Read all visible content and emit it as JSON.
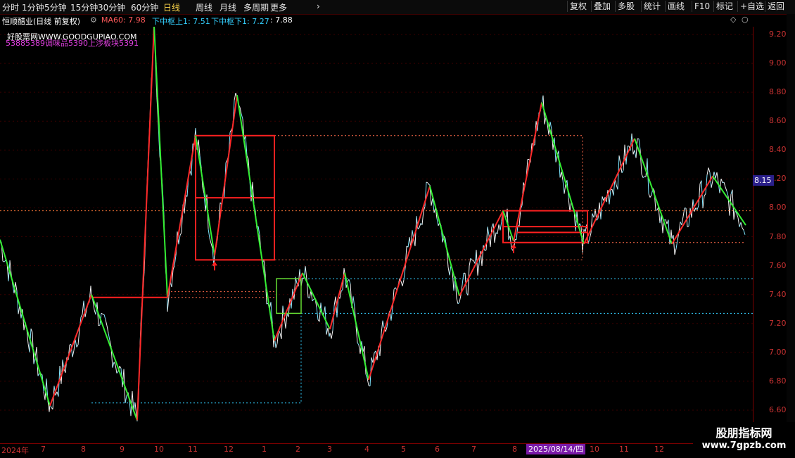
{
  "toolbar": {
    "periods": [
      "分时",
      "1分钟",
      "5分钟",
      "15分钟",
      "30分钟",
      "60分钟",
      "日线",
      "周线",
      "月线",
      "多周期",
      "更多"
    ],
    "active_period": "日线",
    "more_chevron": "›",
    "right_buttons": [
      "复权",
      "叠加",
      "多股",
      "统计",
      "画线",
      "F10",
      "标记",
      "+自选",
      "返回"
    ]
  },
  "info": {
    "stock": "恒顺醋业(日线 前复权)",
    "ma": "MA60: 7.98",
    "upper": "下中枢上1: 7.51",
    "lower": "下中枢下1: 7.27",
    "last": ": 7.88",
    "colors": {
      "ma": "#ff5a5a",
      "upper": "#33d0ff",
      "lower": "#33d0ff"
    }
  },
  "overlay": {
    "watermark": "好股票网WWW.GOODGUPIAO.COM",
    "pink_text": "53885389调味品5390上涉板块5391"
  },
  "price_tag": "8.15",
  "date_tag": "2025/08/14/四",
  "brand": {
    "line1": "股朋指标网",
    "line2": "www.7gpzb.com"
  },
  "chart_data": {
    "type": "line",
    "title": "",
    "xlabel": "",
    "ylabel": "",
    "ylim": [
      6.5,
      9.3
    ],
    "y_ticks": [
      6.6,
      6.8,
      7.0,
      7.2,
      7.4,
      7.6,
      7.8,
      8.0,
      8.2,
      8.4,
      8.6,
      8.8,
      9.0,
      9.2
    ],
    "x_labels": [
      "2024年",
      "7",
      "8",
      "9",
      "10",
      "11",
      "12",
      "1",
      "2",
      "3",
      "4",
      "5",
      "6",
      "7",
      "8",
      "10",
      "11",
      "12"
    ],
    "zigzag_pivots": [
      {
        "x": 0,
        "y": 7.78
      },
      {
        "x": 71,
        "y": 6.63
      },
      {
        "x": 130,
        "y": 7.4
      },
      {
        "x": 195,
        "y": 6.53
      },
      {
        "x": 219,
        "y": 9.26
      },
      {
        "x": 238,
        "y": 7.38
      },
      {
        "x": 278,
        "y": 8.5
      },
      {
        "x": 305,
        "y": 7.67
      },
      {
        "x": 337,
        "y": 8.78
      },
      {
        "x": 390,
        "y": 7.08
      },
      {
        "x": 430,
        "y": 7.55
      },
      {
        "x": 469,
        "y": 7.16
      },
      {
        "x": 490,
        "y": 7.55
      },
      {
        "x": 524,
        "y": 6.81
      },
      {
        "x": 611,
        "y": 8.15
      },
      {
        "x": 653,
        "y": 7.39
      },
      {
        "x": 715,
        "y": 7.98
      },
      {
        "x": 730,
        "y": 7.77
      },
      {
        "x": 770,
        "y": 8.73
      },
      {
        "x": 830,
        "y": 7.75
      },
      {
        "x": 902,
        "y": 8.48
      },
      {
        "x": 955,
        "y": 7.75
      },
      {
        "x": 1013,
        "y": 8.22
      },
      {
        "x": 1060,
        "y": 7.88
      }
    ],
    "hub_boxes": [
      {
        "x1": 278,
        "x2": 390,
        "y_top": 8.5,
        "y_bot": 7.64,
        "mid": 8.07
      },
      {
        "x1": 715,
        "x2": 835,
        "y_top": 7.98,
        "y_bot": 7.76,
        "mid": 7.87
      }
    ],
    "small_box": {
      "x1": 393,
      "x2": 428,
      "y_top": 7.51,
      "y_bot": 7.27
    },
    "levels": [
      {
        "name": "MA60",
        "value": 7.98,
        "color": "#ff5a5a"
      },
      {
        "name": "下中枢上1",
        "value": 7.51,
        "color": "#33d0ff"
      },
      {
        "name": "下中枢下1",
        "value": 7.27,
        "color": "#33d0ff"
      }
    ],
    "up_arrows": [
      {
        "x": 305,
        "y": 7.64
      },
      {
        "x": 730,
        "y": 7.76
      }
    ]
  }
}
